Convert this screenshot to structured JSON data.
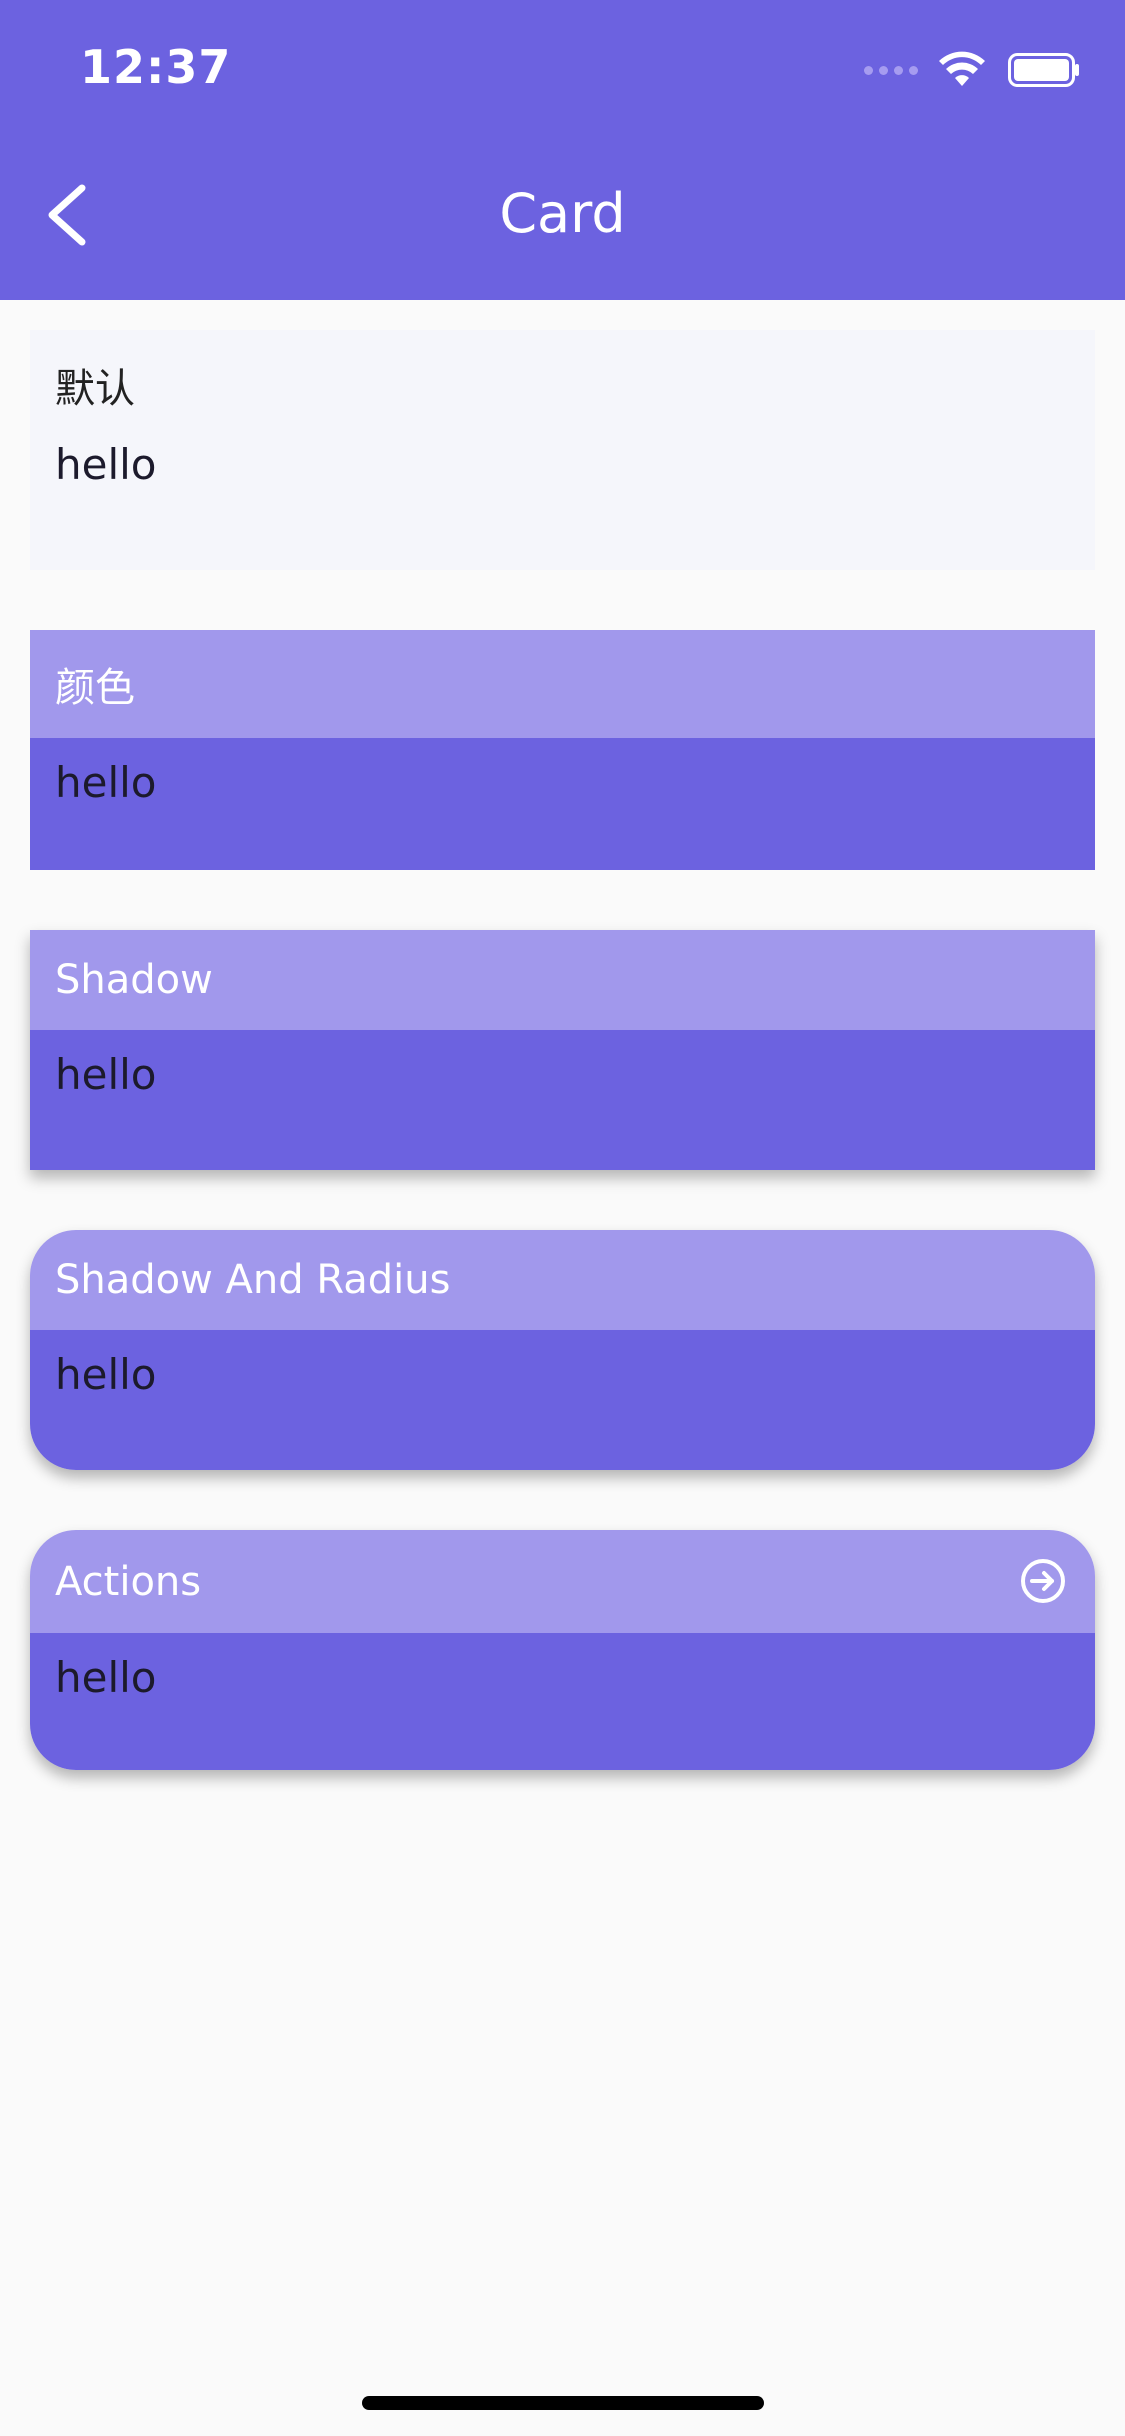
{
  "status": {
    "time": "12:37"
  },
  "nav": {
    "title": "Card"
  },
  "cards": [
    {
      "title": "默认",
      "content": "hello"
    },
    {
      "title": "颜色",
      "content": "hello"
    },
    {
      "title": "Shadow",
      "content": "hello"
    },
    {
      "title": "Shadow And Radius",
      "content": "hello"
    },
    {
      "title": "Actions",
      "content": "hello",
      "action_icon": "arrow-right-circle-icon"
    }
  ],
  "colors": {
    "accent": "#6c62e0",
    "header_light": "#a198ec",
    "background": "#fafafa"
  }
}
